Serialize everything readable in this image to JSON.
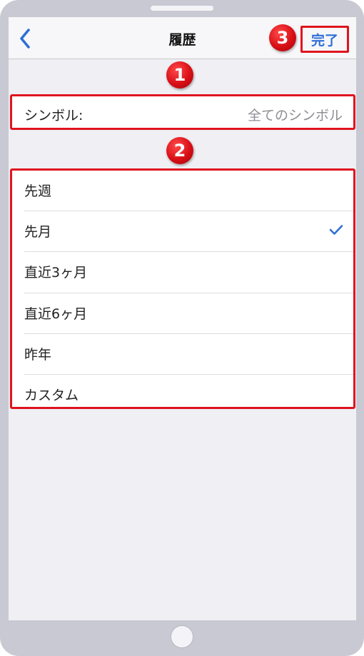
{
  "navbar": {
    "title": "履歴",
    "done_label": "完了",
    "back_icon": "chevron-left-icon"
  },
  "markers": [
    "1",
    "2",
    "3"
  ],
  "symbol": {
    "label": "シンボル:",
    "value": "全てのシンボル"
  },
  "periods": [
    {
      "label": "先週",
      "selected": false
    },
    {
      "label": "先月",
      "selected": true
    },
    {
      "label": "直近3ヶ月",
      "selected": false
    },
    {
      "label": "直近6ヶ月",
      "selected": false
    },
    {
      "label": "昨年",
      "selected": false
    },
    {
      "label": "カスタム",
      "selected": false
    }
  ],
  "colors": {
    "accent": "#2f6fd6",
    "highlight": "#e0141e",
    "background": "#efeff4"
  }
}
